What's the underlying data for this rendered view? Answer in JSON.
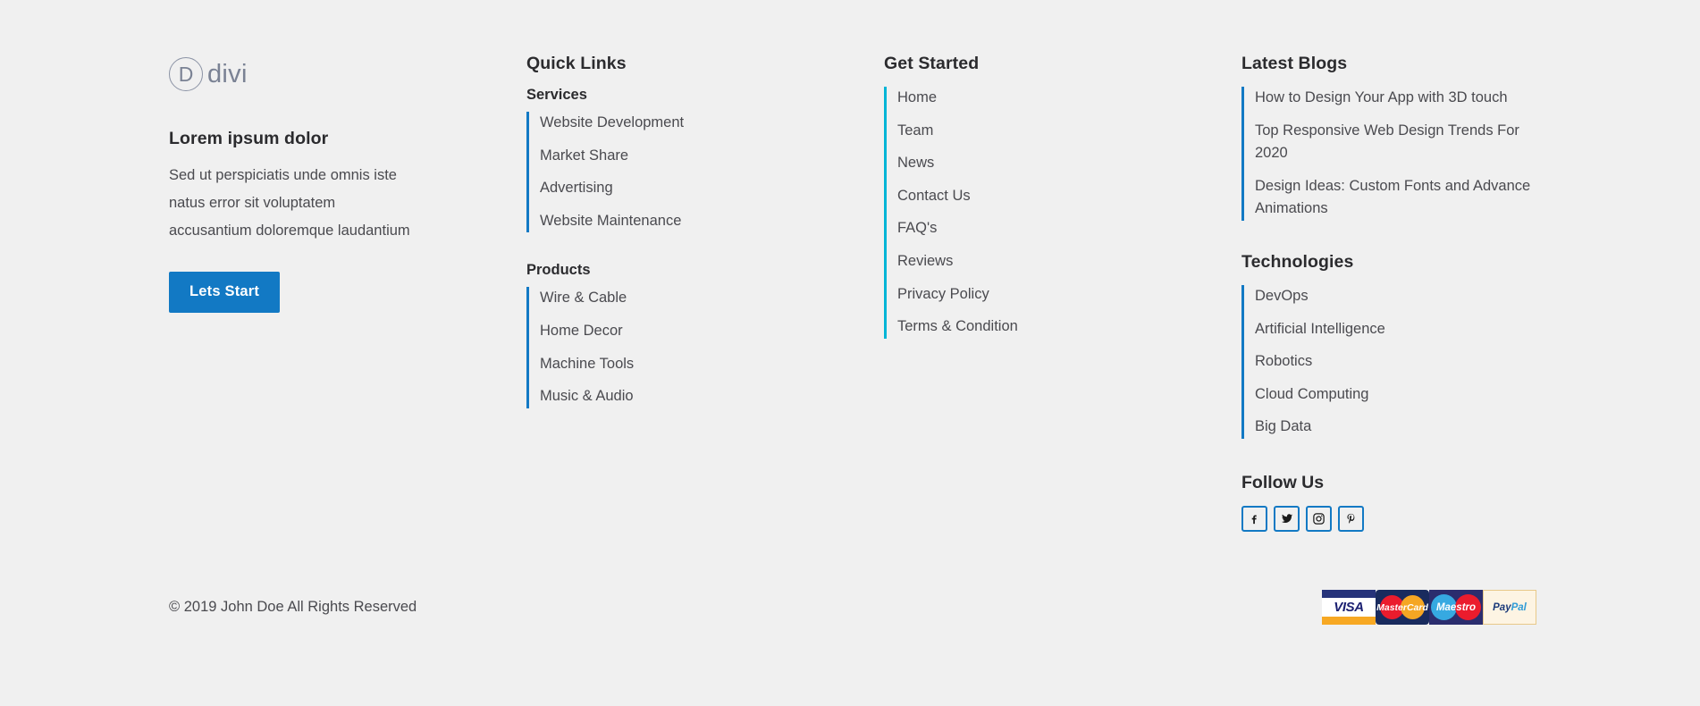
{
  "brand": {
    "logo_letter": "D",
    "logo_word": "divi",
    "title": "Lorem ipsum dolor",
    "description": "Sed ut perspiciatis unde omnis iste natus error sit voluptatem accusantium doloremque laudantium",
    "cta_label": "Lets Start"
  },
  "quick_links": {
    "heading": "Quick Links",
    "services": {
      "label": "Services",
      "items": [
        "Website Development",
        "Market Share",
        "Advertising",
        "Website Maintenance"
      ]
    },
    "products": {
      "label": "Products",
      "items": [
        "Wire & Cable",
        "Home Decor",
        "Machine Tools",
        "Music & Audio"
      ]
    }
  },
  "get_started": {
    "heading": "Get Started",
    "items": [
      "Home",
      "Team",
      "News",
      "Contact Us",
      "FAQ's",
      "Reviews",
      "Privacy Policy",
      "Terms & Condition"
    ]
  },
  "latest_blogs": {
    "heading": "Latest Blogs",
    "items": [
      "How to Design Your App with 3D touch",
      "Top Responsive Web Design Trends For 2020",
      "Design Ideas: Custom Fonts and Advance Animations"
    ]
  },
  "technologies": {
    "heading": "Technologies",
    "items": [
      "DevOps",
      "Artificial Intelligence",
      "Robotics",
      "Cloud Computing",
      "Big Data"
    ]
  },
  "follow_us": {
    "heading": "Follow Us",
    "socials": [
      {
        "name": "facebook",
        "glyph": "f"
      },
      {
        "name": "twitter",
        "glyph": "t"
      },
      {
        "name": "instagram",
        "glyph": "i"
      },
      {
        "name": "pinterest",
        "glyph": "p"
      }
    ]
  },
  "bottom": {
    "copyright": "© 2019 John Doe All Rights Reserved",
    "payments": [
      {
        "name": "visa",
        "label": "VISA"
      },
      {
        "name": "mastercard",
        "label": "MasterCard"
      },
      {
        "name": "maestro",
        "label": "Maestro"
      },
      {
        "name": "paypal",
        "label_left": "Pay",
        "label_right": "Pal"
      }
    ]
  },
  "colors": {
    "background": "#f0f0f0",
    "accent_blue": "#1279c4",
    "accent_cyan": "#00b5d6",
    "text_dark": "#2b2b2e",
    "text_body": "#4a4a4f",
    "logo_gray": "#7a8294"
  }
}
